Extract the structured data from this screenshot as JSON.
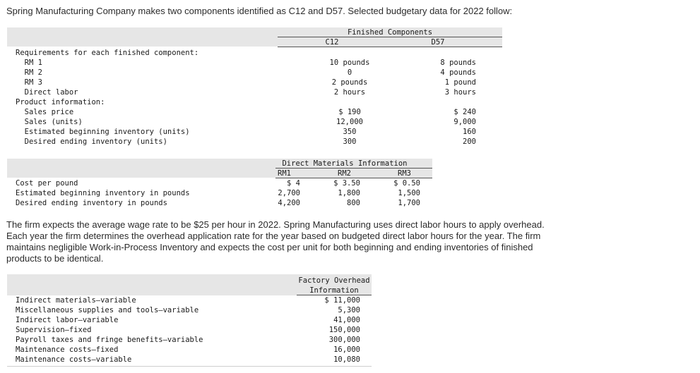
{
  "intro": "Spring Manufacturing Company makes two components identified as C12 and D57. Selected budgetary data for 2022 follow:",
  "table1": {
    "group_header": "Finished Components",
    "col_c12": "C12",
    "col_d57": "D57",
    "rows": [
      {
        "label": "Requirements for each finished component:",
        "c12": "",
        "d57": ""
      },
      {
        "label": "  RM 1",
        "c12": "10 pounds",
        "d57": "8 pounds"
      },
      {
        "label": "  RM 2",
        "c12": "0",
        "d57": "4 pounds"
      },
      {
        "label": "  RM 3",
        "c12": "2 pounds",
        "d57": "1 pound"
      },
      {
        "label": "  Direct labor",
        "c12": "2 hours",
        "d57": "3 hours"
      },
      {
        "label": "Product information:",
        "c12": "",
        "d57": ""
      },
      {
        "label": "  Sales price",
        "c12": "$ 190",
        "d57": "$ 240"
      },
      {
        "label": "  Sales (units)",
        "c12": "12,000",
        "d57": "9,000"
      },
      {
        "label": "  Estimated beginning inventory (units)",
        "c12": "350",
        "d57": "160"
      },
      {
        "label": "  Desired ending inventory (units)",
        "c12": "300",
        "d57": "200"
      }
    ]
  },
  "table2": {
    "group_header": "Direct Materials Information",
    "col_rm1": "RM1",
    "col_rm2": "RM2",
    "col_rm3": "RM3",
    "rows": [
      {
        "label": "Cost per pound",
        "rm1": "$ 4",
        "rm2": "$ 3.50",
        "rm3": "$ 0.50"
      },
      {
        "label": "Estimated beginning inventory in pounds",
        "rm1": "2,700",
        "rm2": "1,800",
        "rm3": "1,500"
      },
      {
        "label": "Desired ending inventory in pounds",
        "rm1": "4,200",
        "rm2": "800",
        "rm3": "1,700"
      }
    ]
  },
  "paragraph": {
    "line1": "The firm expects the average wage rate to be $25 per hour in 2022. Spring Manufacturing uses direct labor hours to apply overhead.",
    "line2": "Each year the firm determines the overhead application rate for the year based on budgeted direct labor hours for the year. The firm",
    "line3": "maintains negligible Work-in-Process Inventory and expects the cost per unit for both beginning and ending inventories of finished",
    "line4": "products to be identical."
  },
  "table3": {
    "header_line1": "Factory Overhead",
    "header_line2": "Information",
    "rows": [
      {
        "label": "Indirect materials—variable",
        "value": "$ 11,000"
      },
      {
        "label": "Miscellaneous supplies and tools—variable",
        "value": "5,300"
      },
      {
        "label": "Indirect labor—variable",
        "value": "41,000"
      },
      {
        "label": "Supervision—fixed",
        "value": "150,000"
      },
      {
        "label": "Payroll taxes and fringe benefits—variable",
        "value": "300,000"
      },
      {
        "label": "Maintenance costs—fixed",
        "value": "16,000"
      },
      {
        "label": "Maintenance costs—variable",
        "value": "10,080"
      }
    ]
  }
}
